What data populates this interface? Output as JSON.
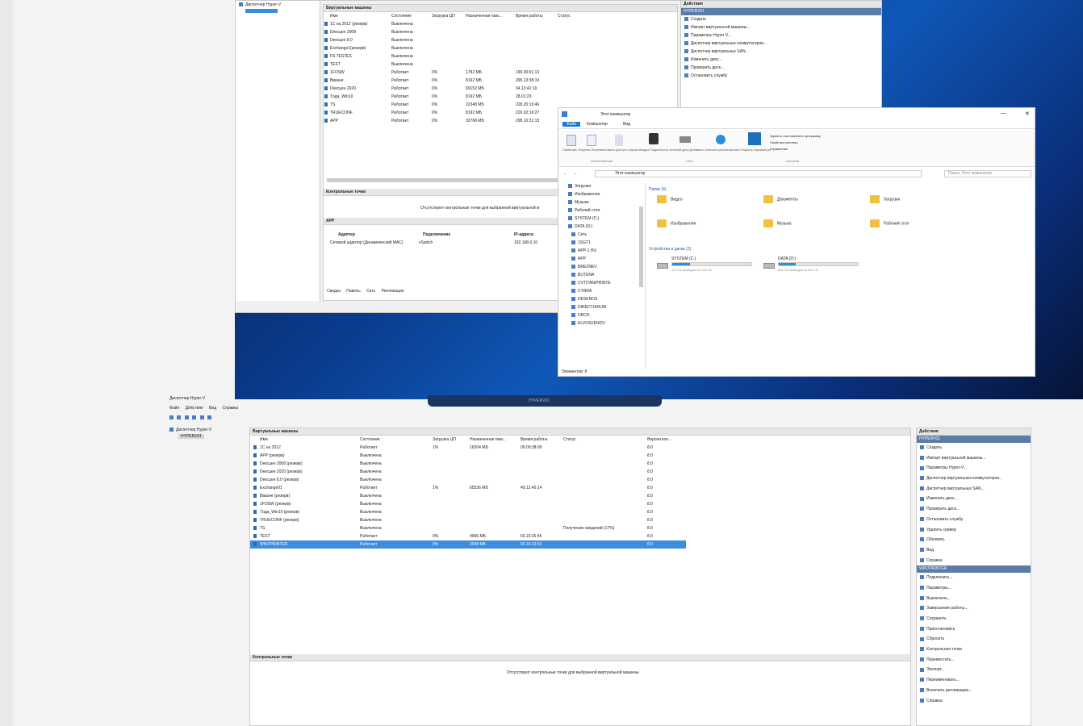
{
  "top": {
    "tree_root": "Диспетчер Hyper-V",
    "vm_header": "Виртуальные машины",
    "columns": [
      "Имя",
      "Состояние",
      "Загрузка ЦП",
      "Назначенная пам...",
      "Время работы",
      "Статус"
    ],
    "vms": [
      [
        "1С на 2012 (резерв)",
        "Выключена",
        "",
        "",
        "",
        ""
      ],
      [
        "Dексцен 2008",
        "Выключена",
        "",
        "",
        "",
        ""
      ],
      [
        "Dексцен 8.0",
        "Выключена",
        "",
        "",
        "",
        ""
      ],
      [
        "Exchange1(резерв)",
        "Выключена",
        "",
        "",
        "",
        ""
      ],
      [
        "FS 7ES7ES",
        "Выключена",
        "",
        "",
        "",
        ""
      ],
      [
        "TEST",
        "Выключена",
        "",
        "",
        "",
        ""
      ],
      [
        "1FOSW",
        "Работает",
        "0%",
        "1782 МБ",
        "190.00:01:13",
        ""
      ],
      [
        "Ввазне",
        "Работает",
        "0%",
        "8192 МБ",
        "295.13:38:19",
        ""
      ],
      [
        "Dексцен 2020",
        "Работает",
        "0%",
        "69152 МБ",
        "34.13:41:10",
        ""
      ],
      [
        "Tода_Win10",
        "Работает",
        "0%",
        "8192 МБ",
        "28.01:23",
        ""
      ],
      [
        "TS",
        "Работает",
        "0%",
        "22348 МБ",
        "228.20:16:46",
        ""
      ],
      [
        "TRUECONF",
        "Работает",
        "0%",
        "8192 МБ",
        "226.02:16:27",
        ""
      ],
      [
        "APP",
        "Работает",
        "0%",
        "32768 МБ",
        "298.10:31:13",
        ""
      ]
    ],
    "checkpoints_header": "Контрольные точки",
    "checkpoints_empty": "Отсутствуют контрольные точки для выбранной виртуальной м",
    "detail_header": "APP",
    "net_cols": [
      "Адаптер",
      "Подключение",
      "IP-адреса"
    ],
    "net_row": [
      "Сетевой адаптер (Динамический МАС)",
      "vSwitch",
      "192.168.0.10"
    ],
    "tabs": [
      "Сводка",
      "Память",
      "Сеть",
      "Репликация"
    ],
    "actions_header": "Действия",
    "actions_sub": "HYPERV01",
    "actions": [
      "Создать",
      "Импорт виртуальной машины...",
      "Параметры Hyper-V...",
      "Диспетчер виртуальных коммутаторов...",
      "Диспетчер виртуальных SAN...",
      "Изменить диск...",
      "Проверить диск...",
      "Остановить службу"
    ]
  },
  "explorer": {
    "title": "Этот компьютер",
    "ribbon_tabs": [
      "Файл",
      "Компьютер",
      "Вид"
    ],
    "ribbon_groups": [
      "Расположение",
      "Сеть",
      "Система"
    ],
    "ribbon_buttons": [
      "Свойства",
      "Открыть",
      "Переименовать",
      "Доступ к мультимедиа",
      "Подключить сетевой диск",
      "Добавить сетевое расположение",
      "Открыть параметры",
      "Удалить или изменить программу",
      "Свойства системы",
      "Управление"
    ],
    "address": "Этот компьютер",
    "search_placeholder": "Поиск: Этот компьютер",
    "nav": [
      "Загрузки",
      "Изображения",
      "Музыка",
      "Рабочий стол",
      "SYSTEM (C:)",
      "DATA (D:)",
      "Сеть",
      "1SGT1",
      "APP-1.HU",
      "APP",
      "BREZNEV",
      "BUTENA",
      "CVTITAN/PRINTE",
      "CYBRA",
      "DESKNOS",
      "DIRECTURIUM",
      "DRCH",
      "KLVOSVENOV"
    ],
    "folders_header": "Папки (6)",
    "folders": [
      "Видео",
      "Документы",
      "Загрузки",
      "Изображения",
      "Музыка",
      "Рабочий стол"
    ],
    "drives_header": "Устройства и диски (2)",
    "drives": [
      {
        "name": "SYSTEM (C:)",
        "free": "117 ГБ свободно из 150 ГБ",
        "fill": 0.22
      },
      {
        "name": "DATA (D:)",
        "free": "644 ГБ свободно из 811 ГБ",
        "fill": 0.21
      }
    ],
    "status": "Элементов: 8"
  },
  "bottom": {
    "app_title": "Диспетчер Hyper-V",
    "menu": [
      "Файл",
      "Действие",
      "Вид",
      "Справка"
    ],
    "tree_root": "Диспетчер Hyper-V",
    "tree_node": "HYPERV01",
    "vm_header": "Виртуальные машины",
    "columns": [
      "Имя",
      "Состояние",
      "Загрузка ЦП",
      "Назначенная пам...",
      "Время работы",
      "Статус",
      "Версия кон..."
    ],
    "vms": [
      [
        "1С на 2012",
        "Работает",
        "1%",
        "16304 МБ",
        "09.09:38:09",
        "",
        "8.0"
      ],
      [
        "APP (резерв)",
        "Выключена",
        "",
        "",
        "",
        "",
        "8.0"
      ],
      [
        "Dексцен 2008 (резерв)",
        "Выключена",
        "",
        "",
        "",
        "",
        "8.0"
      ],
      [
        "Dексцен 2020 (резерв)",
        "Выключена",
        "",
        "",
        "",
        "",
        "8.0"
      ],
      [
        "Dексцен 8.0 (резерв)",
        "Выключена",
        "",
        "",
        "",
        "",
        "8.0"
      ],
      [
        "Exchange01",
        "Работает",
        "1%",
        "65536 МБ",
        "49.12:45:14",
        "",
        "8.0"
      ],
      [
        "Ввазне (резерв)",
        "Выключена",
        "",
        "",
        "",
        "",
        "8.0"
      ],
      [
        "1FOSW (резерв)",
        "Выключена",
        "",
        "",
        "",
        "",
        "8.0"
      ],
      [
        "Tода_Win10 (резерв)",
        "Выключена",
        "",
        "",
        "",
        "",
        "8.0"
      ],
      [
        "TRUECONF (резерв)",
        "Выключена",
        "",
        "",
        "",
        "",
        "8.0"
      ],
      [
        "TS",
        "Выключена",
        "",
        "",
        "",
        "Получение сведений (17%)",
        "8.0"
      ],
      [
        "TEST",
        "Работает",
        "0%",
        "4096 МБ",
        "60.15:26:45",
        "",
        "8.0"
      ],
      [
        "WIN7PRINTER",
        "Работает",
        "0%",
        "2048 МБ",
        "60.16:13:01",
        "",
        "8.0"
      ]
    ],
    "selected_index": 12,
    "checkpoints_header": "Контрольные точки",
    "checkpoints_empty": "Отсутствуют контрольные точки для выбранной виртуальной машины.",
    "actions_header": "Действия",
    "actions_sub1": "HYPERV01",
    "actions1": [
      "Создать",
      "Импорт виртуальной машины...",
      "Параметры Hyper-V...",
      "Диспетчер виртуальных коммутаторов...",
      "Диспетчер виртуальных SAN...",
      "Изменить диск...",
      "Проверить диск...",
      "Остановить службу",
      "Удалить сервер",
      "Обновить",
      "Вид",
      "Справка"
    ],
    "actions_sub2": "WIN7PRINTER",
    "actions2": [
      "Подключить...",
      "Параметры...",
      "Выключить...",
      "Завершение работы...",
      "Сохранить",
      "Приостановить",
      "Сбросить",
      "Контрольная точка",
      "Переместить...",
      "Экспорт...",
      "Переименовать...",
      "Включить репликацию...",
      "Справка"
    ]
  },
  "taskbar": {
    "label": "HYPERV01"
  },
  "colors": {
    "selection": "#3d8ce0",
    "desktop": "#0a3b8c",
    "header_blue": "#5a7ca6"
  }
}
